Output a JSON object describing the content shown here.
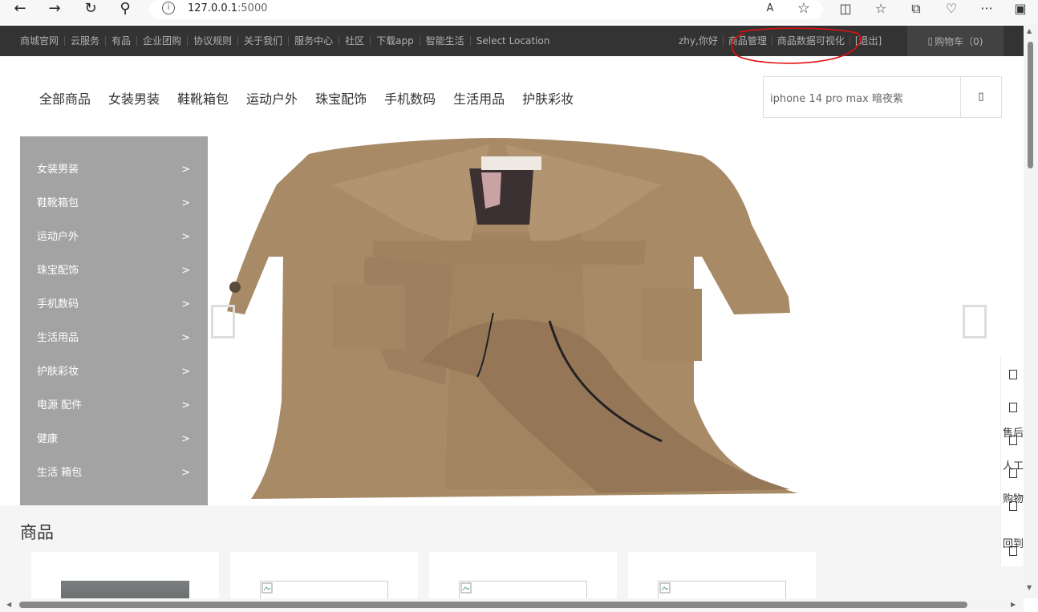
{
  "browser": {
    "back_icon": "←",
    "forward_icon": "→",
    "reload_icon": "↻",
    "search_icon": "⚲",
    "url_host": "127.0.0.1",
    "url_port": ":5000",
    "read_aloud_icon": "A",
    "favorite_icon": "☆",
    "split_icon": "◫",
    "favorites_icon": "☆",
    "collections_icon": "⧉",
    "heart_icon": "♡",
    "menu_icon": "···",
    "sidebar_icon": "▣"
  },
  "topbar": {
    "links": [
      "商城官网",
      "云服务",
      "有品",
      "企业团购",
      "协议规则",
      "关于我们",
      "服务中心",
      "社区",
      "下载app",
      "智能生活",
      "Select Location"
    ],
    "greeting": "zhy,你好",
    "manage": "商品管理",
    "visualize": "商品数据可视化",
    "logout": "[退出]",
    "cart": "购物车（0)",
    "cart_icon": "▯"
  },
  "nav": {
    "items": [
      "全部商品",
      "女装男装",
      "鞋靴箱包",
      "运动户外",
      "珠宝配饰",
      "手机数码",
      "生活用品",
      "护肤彩妆"
    ]
  },
  "search": {
    "value": "iphone 14 pro max 暗夜紫",
    "button_icon": "▯"
  },
  "categories": {
    "arrow": ">",
    "items": [
      "女装男装",
      "鞋靴箱包",
      "运动户外",
      "珠宝配饰",
      "手机数码",
      "生活用品",
      "护肤彩妆",
      "电源 配件",
      "健康",
      "生活 箱包"
    ]
  },
  "banner": {
    "prev_icon": "chevron-left-icon",
    "next_icon": "chevron-right-icon"
  },
  "products": {
    "title": "商品"
  },
  "sidebar": {
    "items": [
      "售后",
      "人工",
      "购物",
      "回到"
    ]
  },
  "colors": {
    "topbar": "#333333",
    "cart_box": "#424242",
    "annotation": "#e01010",
    "coat": "#a88a66"
  }
}
